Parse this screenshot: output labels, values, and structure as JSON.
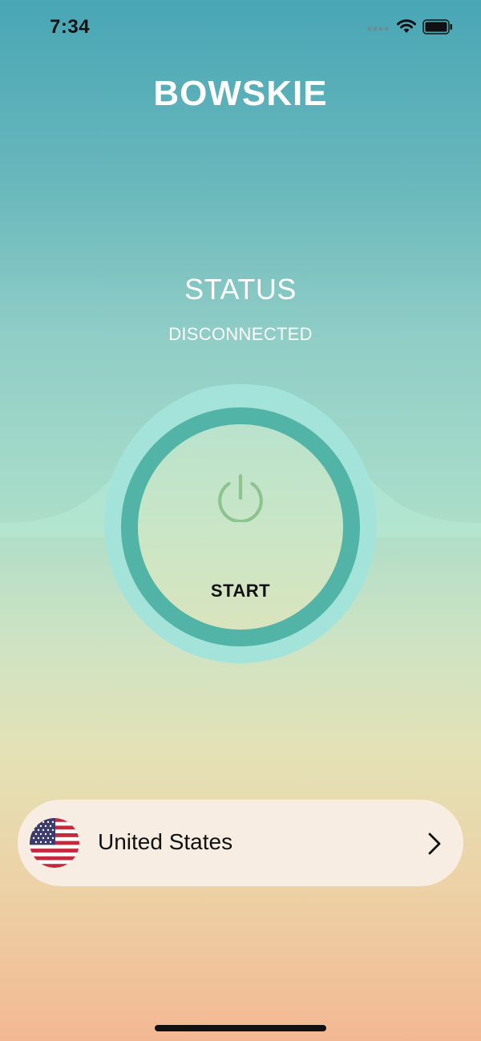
{
  "status_bar": {
    "time": "7:34",
    "icons": [
      "signal-dots-icon",
      "wifi-icon",
      "battery-icon"
    ]
  },
  "app": {
    "title": "BOWSKIE"
  },
  "connection": {
    "label": "STATUS",
    "state": "DISCONNECTED",
    "button_label": "START",
    "button_icon": "power-icon"
  },
  "location": {
    "flag_icon": "us-flag-icon",
    "country": "United States",
    "chevron_icon": "chevron-right-icon"
  },
  "colors": {
    "gradient_top": "#48a6b5",
    "gradient_bottom": "#f3b893",
    "ring": "#52b4a6",
    "halo": "#a3e3d9",
    "power_icon": "#8cc38f",
    "location_bar": "#f8ede2"
  }
}
